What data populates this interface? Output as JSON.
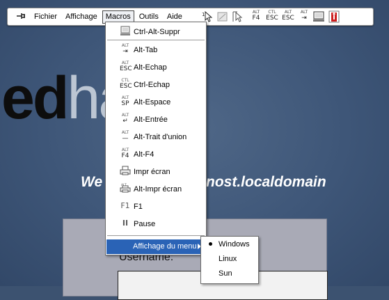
{
  "background": {
    "brand_bold": "ed",
    "brand_light": "ha",
    "welcome_left": "We",
    "welcome_right": "nost.localdomain",
    "username_label": "Username:"
  },
  "toolbar": {
    "pin_icon": "pin-icon",
    "menus": [
      "Fichier",
      "Affichage",
      "Macros",
      "Outils",
      "Aide"
    ],
    "active_menu": "Macros",
    "keys": [
      {
        "top": "ALT",
        "bottom": "F4"
      },
      {
        "top": "CTL",
        "bottom": "ESC"
      },
      {
        "top": "ALT",
        "bottom": "ESC"
      },
      {
        "top": "ALT",
        "bottom": "⇥"
      }
    ]
  },
  "macros_menu": {
    "items": [
      {
        "label": "Ctrl-Alt-Suppr",
        "icon": "keyboard-icon"
      },
      {
        "label": "Alt-Tab",
        "icon_top": "ALT",
        "icon_bottom": "⇥"
      },
      {
        "label": "Alt-Echap",
        "icon_top": "ALT",
        "icon_bottom": "ESC"
      },
      {
        "label": "Ctrl-Echap",
        "icon_top": "CTL",
        "icon_bottom": "ESC"
      },
      {
        "label": "Alt-Espace",
        "icon_top": "ALT",
        "icon_bottom": "SP"
      },
      {
        "label": "Alt-Entrée",
        "icon_top": "ALT",
        "icon_bottom": "↵"
      },
      {
        "label": "Alt-Trait d'union",
        "icon_top": "ALT",
        "icon_bottom": "—"
      },
      {
        "label": "Alt-F4",
        "icon_top": "ALT",
        "icon_bottom": "F4"
      },
      {
        "label": "Impr écran",
        "icon": "printer-icon"
      },
      {
        "label": "Alt-Impr écran",
        "icon": "printer-alt-icon"
      },
      {
        "label": "F1",
        "icon_text": "F1"
      },
      {
        "label": "Pause",
        "icon_text": "II"
      }
    ],
    "submenu_label": "Affichage du menu",
    "submenu_items": [
      "Windows",
      "Linux",
      "Sun"
    ],
    "submenu_selected": "Windows"
  },
  "colors": {
    "highlight": "#2a63b6",
    "desktop": "#3e5678",
    "login_panel": "#a9aab6"
  }
}
